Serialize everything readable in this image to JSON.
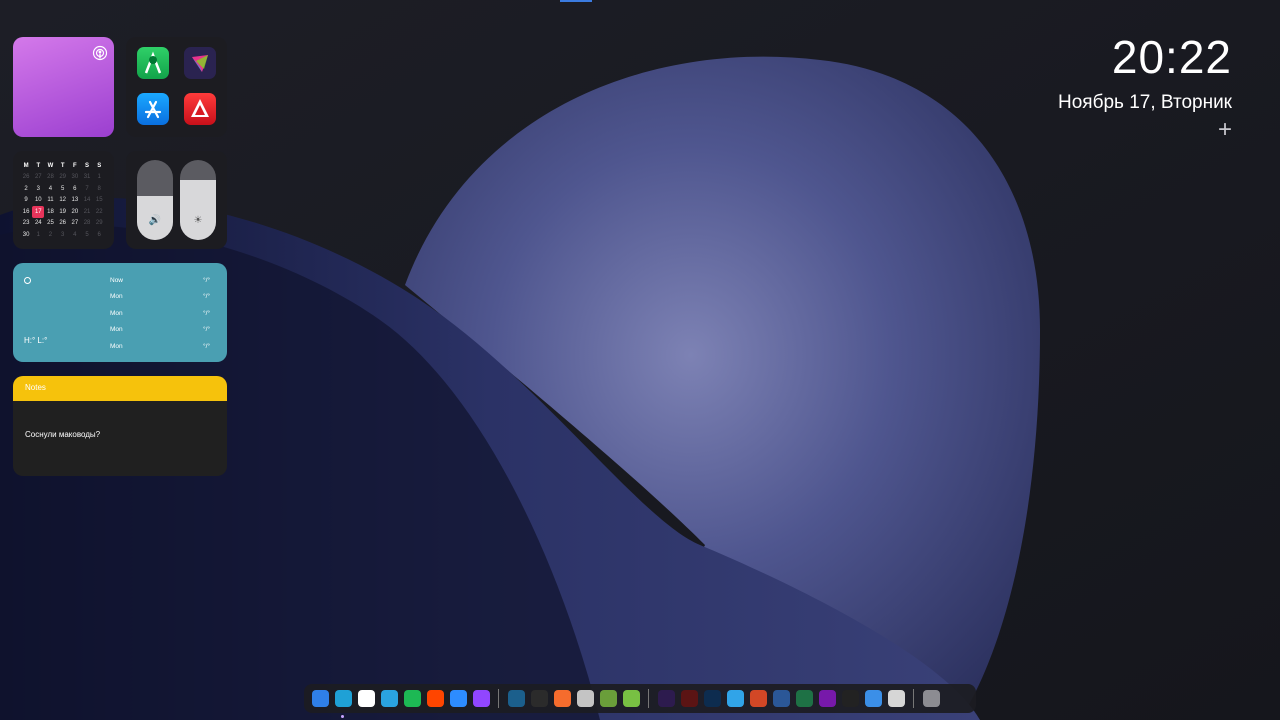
{
  "clock": {
    "time": "20:22",
    "date": "Ноябрь 17, Вторник",
    "add_label": "+"
  },
  "calendar": {
    "weekdays": [
      "M",
      "T",
      "W",
      "T",
      "F",
      "S",
      "S"
    ],
    "rows": [
      [
        "26",
        "27",
        "28",
        "29",
        "30",
        "31",
        "1"
      ],
      [
        "2",
        "3",
        "4",
        "5",
        "6",
        "7",
        "8"
      ],
      [
        "9",
        "10",
        "11",
        "12",
        "13",
        "14",
        "15"
      ],
      [
        "16",
        "17",
        "18",
        "19",
        "20",
        "21",
        "22"
      ],
      [
        "23",
        "24",
        "25",
        "26",
        "27",
        "28",
        "29"
      ],
      [
        "30",
        "1",
        "2",
        "3",
        "4",
        "5",
        "6"
      ]
    ],
    "today": "17"
  },
  "controls": {
    "volume_level": 0.55,
    "brightness_level": 0.75,
    "volume_icon": "speaker-icon",
    "brightness_icon": "sun-icon"
  },
  "weather": {
    "high_low": "H:° L:°",
    "rows": [
      {
        "day": "Now",
        "temp": "°/°"
      },
      {
        "day": "Mon",
        "temp": "°/°"
      },
      {
        "day": "Mon",
        "temp": "°/°"
      },
      {
        "day": "Mon",
        "temp": "°/°"
      },
      {
        "day": "Mon",
        "temp": "°/°"
      }
    ]
  },
  "notes": {
    "title": "Notes",
    "text": "Соснули маководы?"
  },
  "apps_widget": [
    "android-studio-icon",
    "affinity-icon",
    "app-store-icon",
    "vivaldi-like-red-icon"
  ],
  "dock": {
    "items": [
      {
        "name": "finder-icon",
        "color": "#2f7fe8"
      },
      {
        "name": "edge-icon",
        "color": "#1fa1d6"
      },
      {
        "name": "onedrive-icon",
        "color": "#ffffff"
      },
      {
        "name": "telegram-icon",
        "color": "#2aa3e0"
      },
      {
        "name": "spotify-icon",
        "color": "#1db954"
      },
      {
        "name": "reddit-icon",
        "color": "#ff4500"
      },
      {
        "name": "zoom-icon",
        "color": "#2d8cff"
      },
      {
        "name": "twitch-icon",
        "color": "#9146ff"
      },
      {
        "name": "steam-icon",
        "color": "#1b5f8c"
      },
      {
        "name": "epic-games-icon",
        "color": "#2b2b2b"
      },
      {
        "name": "origin-icon",
        "color": "#f56c2d"
      },
      {
        "name": "tools-icon",
        "color": "#c4c4c4"
      },
      {
        "name": "minecraft-icon",
        "color": "#6a9e3a"
      },
      {
        "name": "utorrent-icon",
        "color": "#78c043"
      },
      {
        "name": "after-effects-icon",
        "color": "#2d1b4e"
      },
      {
        "name": "animate-icon",
        "color": "#5b1414"
      },
      {
        "name": "photoshop-icon",
        "color": "#0d2c4f"
      },
      {
        "name": "affinity-designer-icon",
        "color": "#31a4e8"
      },
      {
        "name": "powerpoint-icon",
        "color": "#d24726"
      },
      {
        "name": "word-icon",
        "color": "#2b5797"
      },
      {
        "name": "excel-icon",
        "color": "#1e7145"
      },
      {
        "name": "onenote-icon",
        "color": "#7719aa"
      },
      {
        "name": "undo-app-icon",
        "color": "#222222"
      },
      {
        "name": "vpn-shield-icon",
        "color": "#3b8fe8"
      },
      {
        "name": "trash-icon",
        "color": "#d6d6d6"
      },
      {
        "name": "settings-icon",
        "color": "#8c8c92"
      }
    ],
    "separator_after": [
      7,
      13,
      24
    ]
  }
}
